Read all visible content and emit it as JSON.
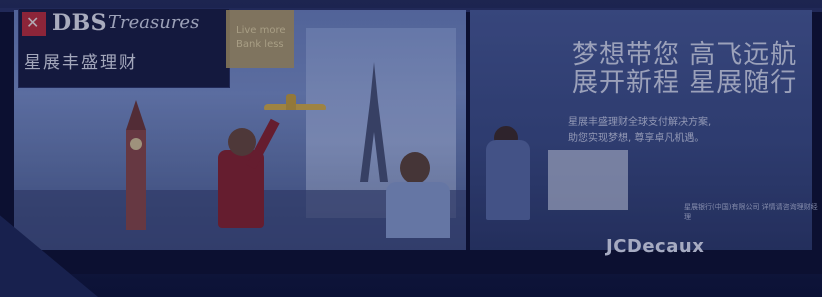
{
  "ad": {
    "brand_mark": "✕",
    "brand_name": "DBS",
    "brand_script": "Treasures",
    "brand_cn": "星展丰盛理财",
    "gold_tag": "Live more Bank less",
    "headline_line1": "梦想带您 高飞远航",
    "headline_line2": "展开新程 星展随行",
    "sub_line1": "星展丰盛理财全球支付解决方案,",
    "sub_line2": "助您实现梦想, 尊享卓凡机遇。",
    "fine_print": "星展银行(中国)有限公司 详情请咨询理财经理",
    "operator": "JCDecaux"
  },
  "colors": {
    "brand_red": "#c0303e",
    "overlay": "#1a2250"
  }
}
